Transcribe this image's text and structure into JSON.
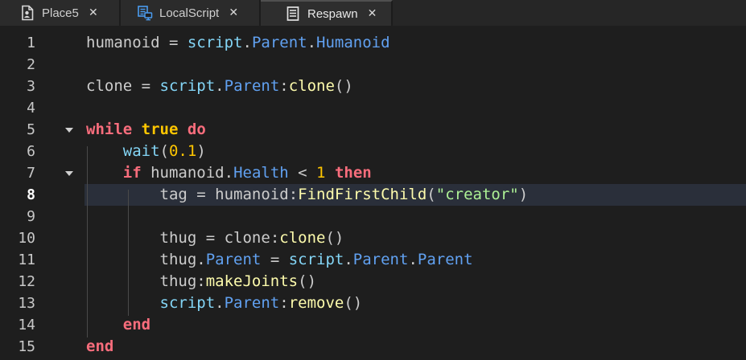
{
  "tabs": [
    {
      "label": "Place5",
      "icon": "place-document-icon",
      "active": false
    },
    {
      "label": "LocalScript",
      "icon": "local-script-icon",
      "active": false
    },
    {
      "label": "Respawn",
      "icon": "script-icon",
      "active": true
    }
  ],
  "tab_close_glyph": "✕",
  "editor": {
    "current_line": 8,
    "lines": [
      {
        "n": "1",
        "tokens": [
          [
            "t-id",
            "humanoid"
          ],
          [
            "t-op",
            " = "
          ],
          [
            "t-blt",
            "script"
          ],
          [
            "t-op",
            "."
          ],
          [
            "t-prop",
            "Parent"
          ],
          [
            "t-op",
            "."
          ],
          [
            "t-prop",
            "Humanoid"
          ]
        ]
      },
      {
        "n": "2",
        "tokens": []
      },
      {
        "n": "3",
        "tokens": [
          [
            "t-id",
            "clone"
          ],
          [
            "t-op",
            " = "
          ],
          [
            "t-blt",
            "script"
          ],
          [
            "t-op",
            "."
          ],
          [
            "t-prop",
            "Parent"
          ],
          [
            "t-op",
            ":"
          ],
          [
            "t-mth",
            "clone"
          ],
          [
            "t-op",
            "()"
          ]
        ]
      },
      {
        "n": "4",
        "tokens": []
      },
      {
        "n": "5",
        "tokens": [
          [
            "t-kw",
            "while"
          ],
          [
            "t-op",
            " "
          ],
          [
            "t-bool",
            "true"
          ],
          [
            "t-op",
            " "
          ],
          [
            "t-kw",
            "do"
          ]
        ],
        "fold": true
      },
      {
        "n": "6",
        "tokens": [
          [
            "t-op",
            "    "
          ],
          [
            "t-blt",
            "wait"
          ],
          [
            "t-op",
            "("
          ],
          [
            "t-num",
            "0.1"
          ],
          [
            "t-op",
            ")"
          ]
        ]
      },
      {
        "n": "7",
        "tokens": [
          [
            "t-op",
            "    "
          ],
          [
            "t-kw",
            "if"
          ],
          [
            "t-op",
            " "
          ],
          [
            "t-id",
            "humanoid"
          ],
          [
            "t-op",
            "."
          ],
          [
            "t-prop",
            "Health"
          ],
          [
            "t-op",
            " < "
          ],
          [
            "t-num",
            "1"
          ],
          [
            "t-op",
            " "
          ],
          [
            "t-kw",
            "then"
          ]
        ],
        "fold": true
      },
      {
        "n": "8",
        "tokens": [
          [
            "t-op",
            "        "
          ],
          [
            "t-id",
            "tag"
          ],
          [
            "t-op",
            " = "
          ],
          [
            "t-id",
            "humanoid"
          ],
          [
            "t-op",
            ":"
          ],
          [
            "t-mth",
            "FindFirstChild"
          ],
          [
            "t-op",
            "("
          ],
          [
            "t-str",
            "\"creator\""
          ],
          [
            "t-op",
            ")"
          ]
        ]
      },
      {
        "n": "9",
        "tokens": []
      },
      {
        "n": "10",
        "tokens": [
          [
            "t-op",
            "        "
          ],
          [
            "t-id",
            "thug"
          ],
          [
            "t-op",
            " = "
          ],
          [
            "t-id",
            "clone"
          ],
          [
            "t-op",
            ":"
          ],
          [
            "t-mth",
            "clone"
          ],
          [
            "t-op",
            "()"
          ]
        ]
      },
      {
        "n": "11",
        "tokens": [
          [
            "t-op",
            "        "
          ],
          [
            "t-id",
            "thug"
          ],
          [
            "t-op",
            "."
          ],
          [
            "t-prop",
            "Parent"
          ],
          [
            "t-op",
            " = "
          ],
          [
            "t-blt",
            "script"
          ],
          [
            "t-op",
            "."
          ],
          [
            "t-prop",
            "Parent"
          ],
          [
            "t-op",
            "."
          ],
          [
            "t-prop",
            "Parent"
          ]
        ]
      },
      {
        "n": "12",
        "tokens": [
          [
            "t-op",
            "        "
          ],
          [
            "t-id",
            "thug"
          ],
          [
            "t-op",
            ":"
          ],
          [
            "t-mth",
            "makeJoints"
          ],
          [
            "t-op",
            "()"
          ]
        ]
      },
      {
        "n": "13",
        "tokens": [
          [
            "t-op",
            "        "
          ],
          [
            "t-blt",
            "script"
          ],
          [
            "t-op",
            "."
          ],
          [
            "t-prop",
            "Parent"
          ],
          [
            "t-op",
            ":"
          ],
          [
            "t-mth",
            "remove"
          ],
          [
            "t-op",
            "()"
          ]
        ]
      },
      {
        "n": "14",
        "tokens": [
          [
            "t-op",
            "    "
          ],
          [
            "t-kw",
            "end"
          ]
        ]
      },
      {
        "n": "15",
        "tokens": [
          [
            "t-kw",
            "end"
          ]
        ]
      }
    ]
  },
  "colors": {
    "background": "#1e1e1e",
    "tab_bar": "#2b2b2b",
    "current_line_highlight": "#2a2f3a",
    "keyword": "#f86d7c",
    "boolean_number": "#ffc600",
    "builtin": "#84d6f7",
    "property": "#61a1f1",
    "method": "#fdfbac",
    "string": "#adf195",
    "identifier": "#cccccc"
  }
}
